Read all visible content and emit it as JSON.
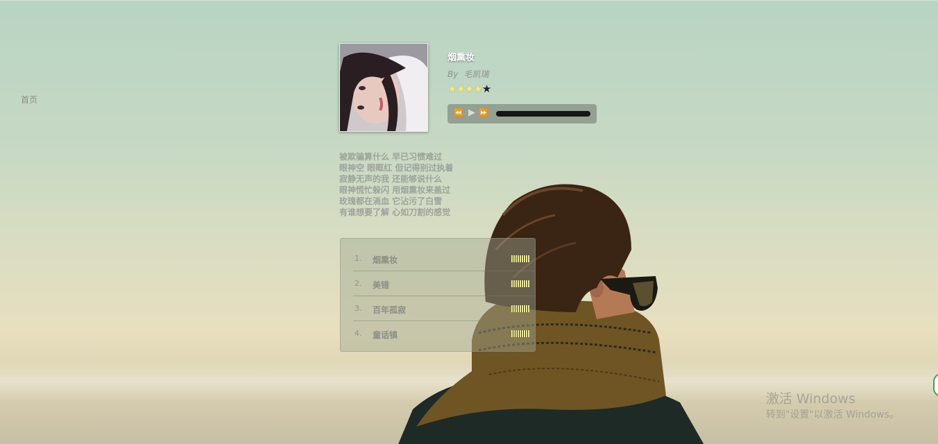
{
  "nav": {
    "home_label": "首页"
  },
  "album": {
    "cover_icon": "album-cover-photo",
    "title": "烟熏妆",
    "by_label": "By",
    "artist": "毛凯瑞",
    "rating": 4,
    "rating_max": 5
  },
  "player": {
    "prev_icon": "rewind-icon",
    "play_icon": "play-icon",
    "next_icon": "fast-forward-icon",
    "progress": 1.0
  },
  "lyrics": [
    "被欺骗算什么 早已习惯难过",
    "眼神空 眼眶红 但记得别过执着",
    "寂静无声的我 还能够说什么",
    "眼神慌忙躲闪 用烟熏妆来盖过",
    "玫瑰都在淌血 它沾污了白雪",
    "有谁想要了解 心如刀割的感觉"
  ],
  "playlist": [
    {
      "num": "1.",
      "title": "烟熏妆"
    },
    {
      "num": "2.",
      "title": "美错"
    },
    {
      "num": "3.",
      "title": "百年孤寂"
    },
    {
      "num": "4.",
      "title": "童话镇"
    }
  ],
  "watermark": {
    "line1": "激活 Windows",
    "line2": "转到\"设置\"以激活 Windows。"
  },
  "colors": {
    "star_on": "#f3ea86",
    "star_off": "#1f1f1f",
    "eq_bar": "#f1ec8a"
  }
}
